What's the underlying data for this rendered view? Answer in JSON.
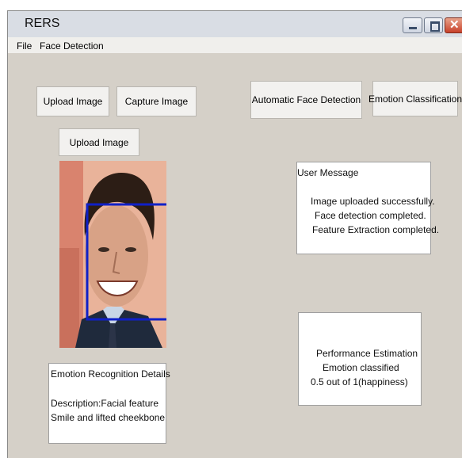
{
  "window": {
    "title": "RERS"
  },
  "menu": {
    "file": "File",
    "face_detection": "Face Detection"
  },
  "buttons": {
    "upload_image": "Upload Image",
    "capture_image": "Capture Image",
    "automatic_face_detection": "Automatic Face Detection",
    "emotion_classification": "Emotion Classification",
    "upload_image_2": "Upload Image"
  },
  "user_message": {
    "heading": "User Message",
    "lines": [
      "Image uploaded successfully.",
      "Face detection completed.",
      "Feature Extraction completed."
    ]
  },
  "emotion_details": {
    "heading": "Emotion Recognition Details",
    "lines": [
      "Description:Facial feature",
      "Smile and lifted cheekbone"
    ]
  },
  "performance": {
    "lines": [
      "Performance Estimation",
      "Emotion classified",
      "0.5 out of 1(happiness)"
    ]
  },
  "colors": {
    "detection_box": "#1020c8",
    "close_button": "#c8412a",
    "window_bg": "#d5d0c8"
  },
  "icons": [
    "minimize-icon",
    "maximize-icon",
    "close-icon"
  ]
}
